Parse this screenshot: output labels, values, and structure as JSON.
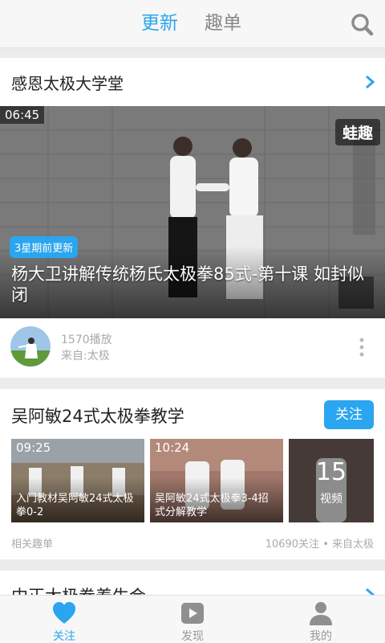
{
  "colors": {
    "accent": "#2aa5f0",
    "muted": "#aaaaaa",
    "background": "#ececec"
  },
  "top_tabs": [
    {
      "label": "更新",
      "active": true
    },
    {
      "label": "趣单",
      "active": false
    }
  ],
  "search": {
    "icon": "search-icon"
  },
  "feed": {
    "channel_title": "感恩太极大学堂",
    "video": {
      "duration": "06:45",
      "watermark": "蛙趣",
      "badge": "3星期前更新",
      "title": "杨大卫讲解传统杨氏太极拳85式-第十课 如封似闭"
    },
    "meta": {
      "plays": "1570播放",
      "source": "来自:太极"
    }
  },
  "playlist": {
    "title": "吴阿敏24式太极拳教学",
    "follow_label": "关注",
    "thumbs": [
      {
        "duration": "09:25",
        "caption": "入门教材吴阿敏24式太极拳0-2"
      },
      {
        "duration": "10:24",
        "caption": "吴阿敏24式太极拳3-4招式分解教学"
      }
    ],
    "more": {
      "count": "15",
      "label": "视频"
    },
    "related_label": "相关趣单",
    "stats": "10690关注 • 来自太极"
  },
  "next_card": {
    "title": "中正太极拳养生会"
  },
  "bottom_nav": [
    {
      "label": "关注",
      "icon": "heart-icon",
      "active": true
    },
    {
      "label": "发现",
      "icon": "play-icon",
      "active": false
    },
    {
      "label": "我的",
      "icon": "person-icon",
      "active": false
    }
  ]
}
